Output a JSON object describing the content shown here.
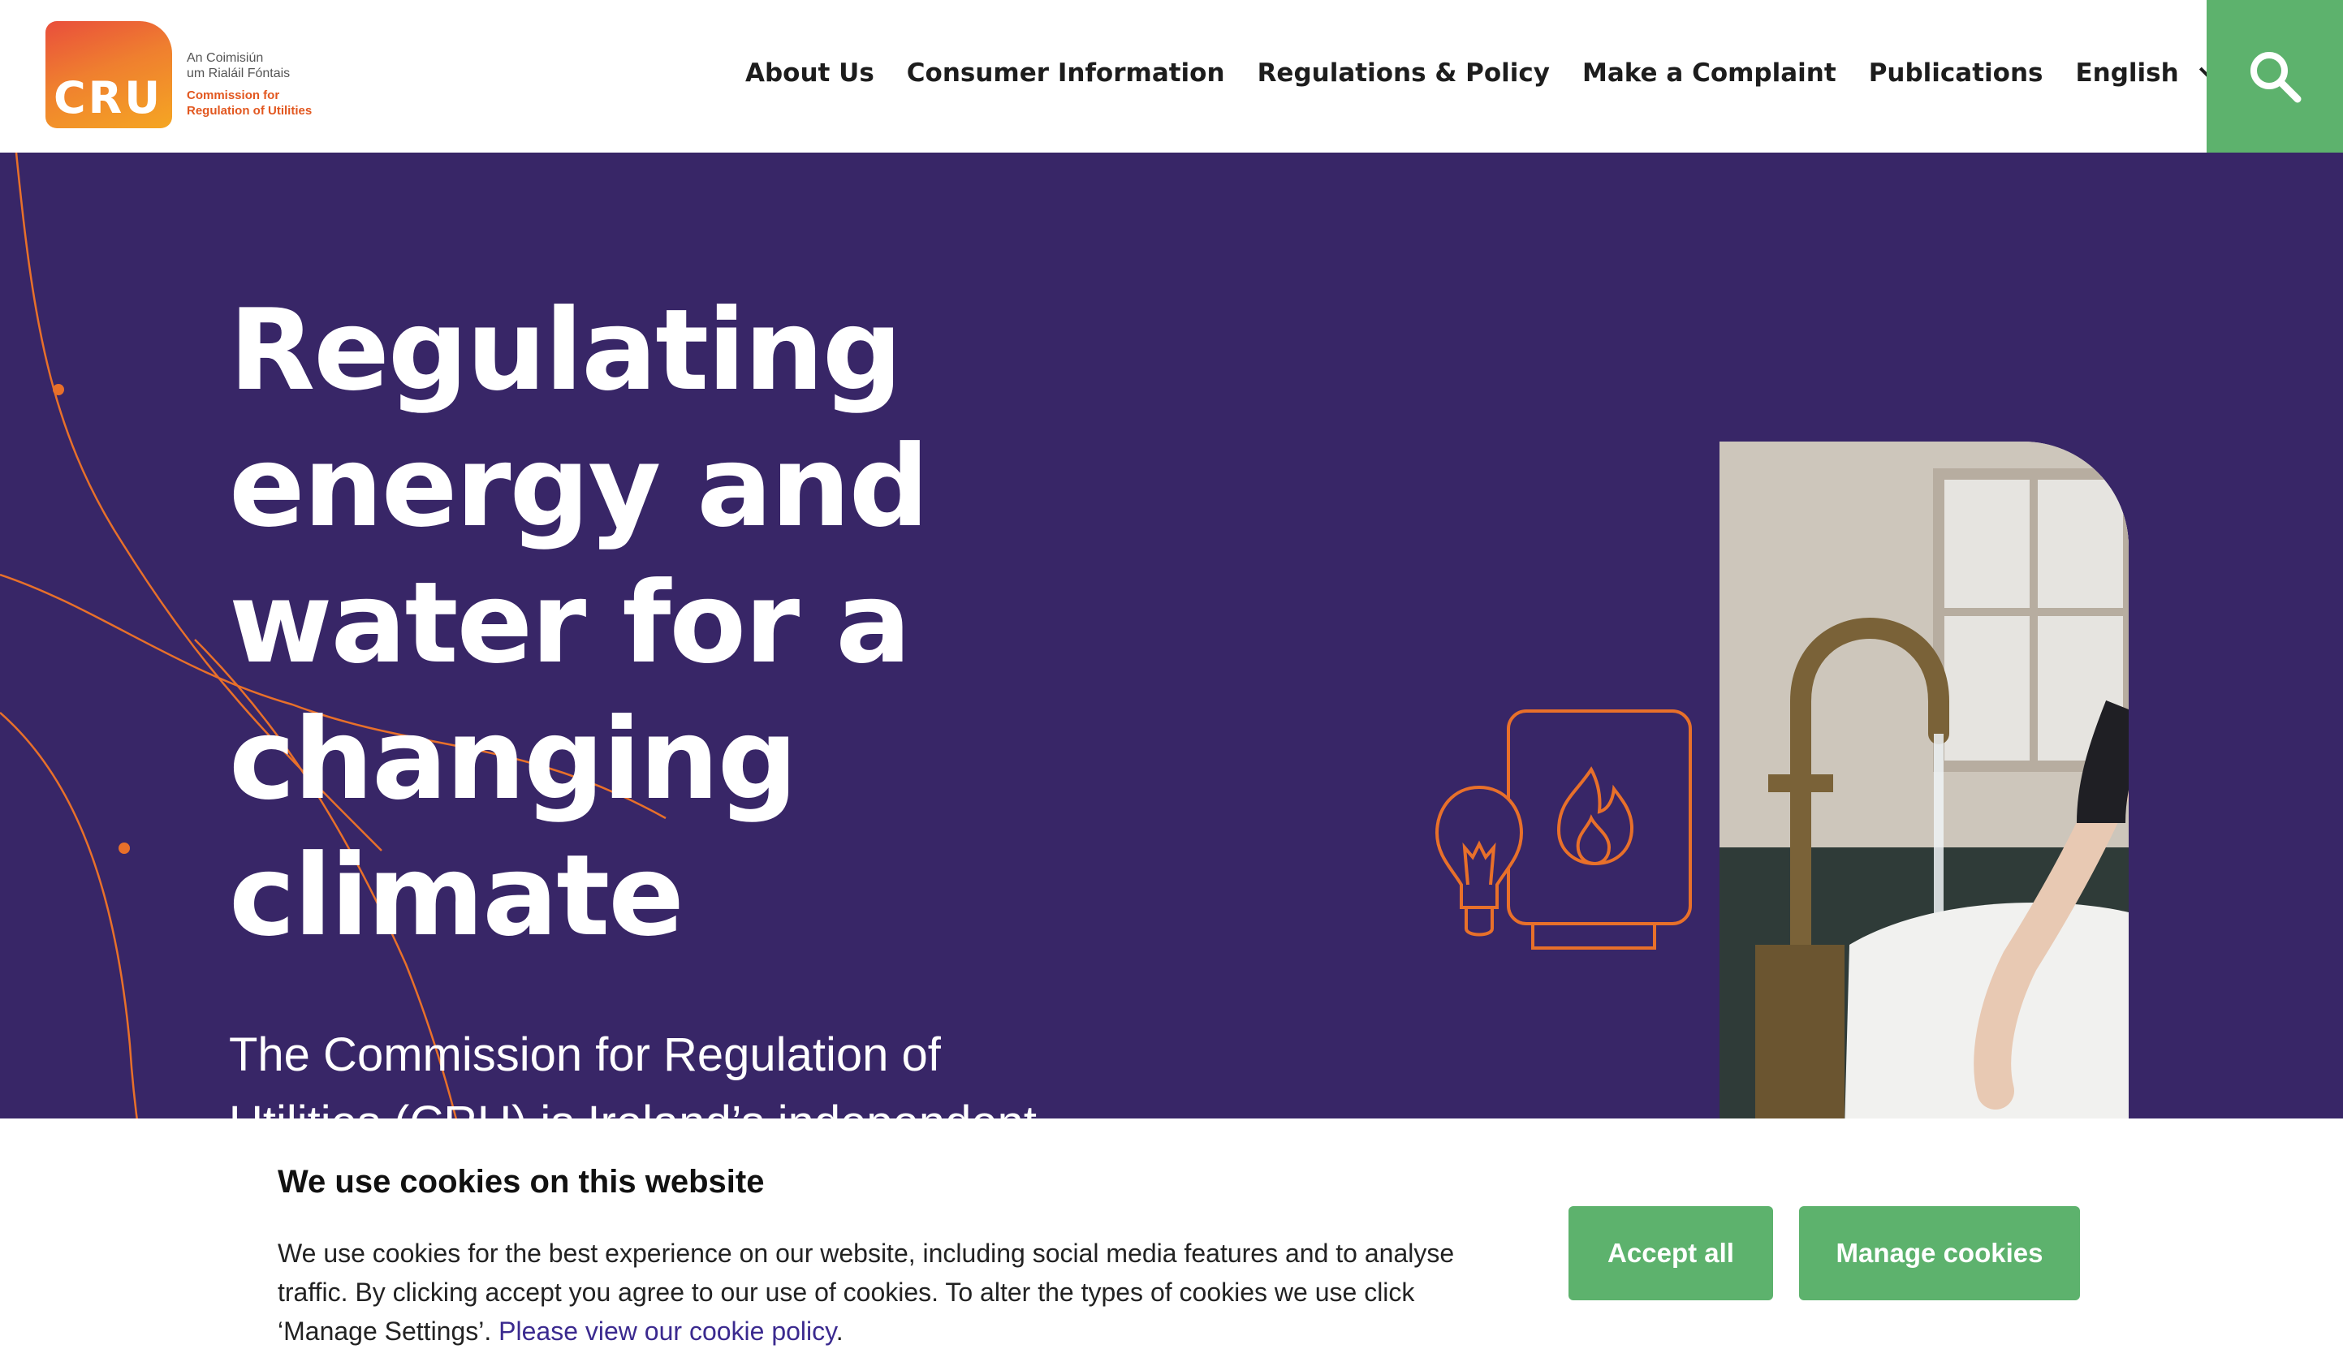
{
  "header": {
    "logo": {
      "mark_text": "CRU",
      "irish_line1": "An Coimisiún",
      "irish_line2": "um Rialáil Fóntais",
      "english_line1": "Commission for",
      "english_line2": "Regulation of Utilities"
    },
    "nav": [
      {
        "label": "About Us"
      },
      {
        "label": "Consumer Information"
      },
      {
        "label": "Regulations & Policy"
      },
      {
        "label": "Make a Complaint"
      },
      {
        "label": "Publications"
      }
    ],
    "language": "English",
    "search_icon": "search-icon"
  },
  "hero": {
    "title_lines": [
      "Regulating",
      "energy and",
      "water for a",
      "changing",
      "climate"
    ],
    "description_lines": [
      "The Commission for Regulation of",
      "Utilities (CRU) is Ireland’s independent"
    ],
    "icons": [
      "lightbulb-icon",
      "boiler-flame-icon"
    ]
  },
  "cookie_banner": {
    "title": "We use cookies on this website",
    "text": "We use cookies for the best experience on our website, including social media features and to analyse traffic. By clicking accept you agree to our use of cookies. To alter the types of cookies we use click ‘Manage Settings’.",
    "link_text": "Please view our cookie policy",
    "link_suffix": ".",
    "accept_label": "Accept all",
    "manage_label": "Manage cookies"
  },
  "colors": {
    "hero_bg": "#382667",
    "accent_green": "#5db26d",
    "accent_orange": "#e2571f",
    "link_purple": "#3b2a8f"
  }
}
